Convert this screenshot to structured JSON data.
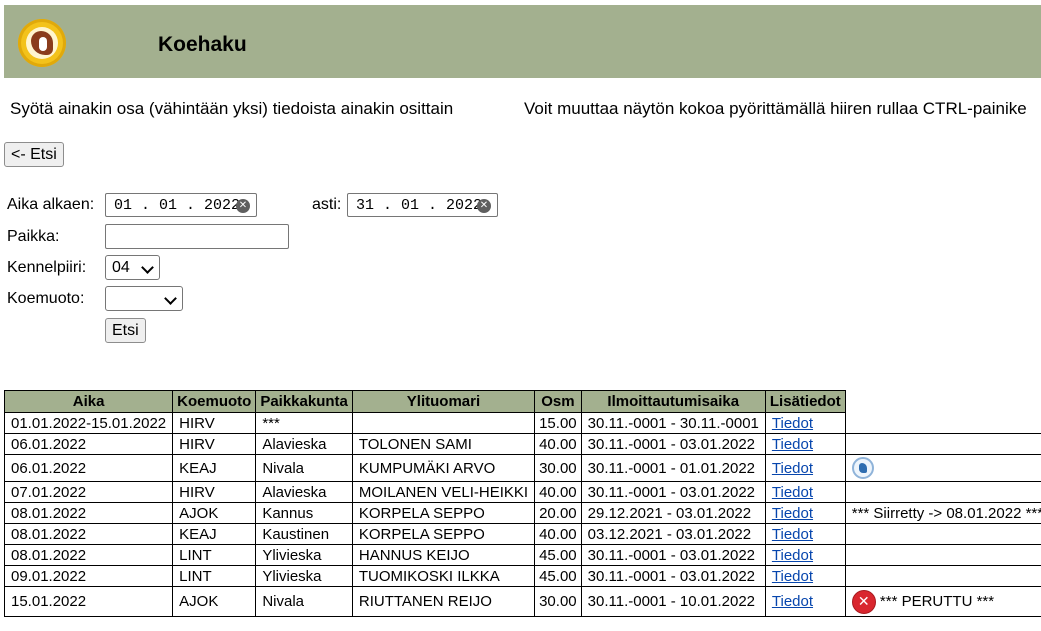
{
  "header": {
    "title": "Koehaku"
  },
  "intro": {
    "left": "Syötä ainakin osa (vähintään yksi) tiedoista ainakin osittain",
    "right": "Voit muuttaa näytön kokoa pyörittämällä hiiren rullaa CTRL-painike"
  },
  "back_button": "<- Etsi",
  "form": {
    "start_label": "Aika alkaen:",
    "start_value": "01 . 01 . 2022",
    "end_label": "asti:",
    "end_value": "31 . 01 . 2022",
    "place_label": "Paikka:",
    "place_value": "",
    "kennel_label": "Kennelpiiri:",
    "kennel_value": "04",
    "type_label": "Koemuoto:",
    "type_value": "",
    "search_button": "Etsi"
  },
  "table": {
    "headers": [
      "Aika",
      "Koemuoto",
      "Paikkakunta",
      "Ylituomari",
      "Osm",
      "Ilmoittautumisaika",
      "Lisätiedot"
    ],
    "rows": [
      {
        "aika": "01.01.2022-15.01.2022",
        "koemuoto": "HIRV",
        "paikka": "***",
        "tuomari": "",
        "osm": "15.00",
        "ilmo": "30.11.-0001 - 30.11.-0001",
        "link": "Tiedot",
        "note": "",
        "icon": "",
        "note_cell": false
      },
      {
        "aika": "06.01.2022",
        "koemuoto": "HIRV",
        "paikka": "Alavieska",
        "tuomari": "TOLONEN SAMI",
        "osm": "40.00",
        "ilmo": "30.11.-0001 - 03.01.2022",
        "link": "Tiedot",
        "note": "",
        "icon": "",
        "note_cell": true
      },
      {
        "aika": "06.01.2022",
        "koemuoto": "KEAJ",
        "paikka": "Nivala",
        "tuomari": "KUMPUMÄKI ARVO",
        "osm": "30.00",
        "ilmo": "30.11.-0001 - 01.01.2022",
        "link": "Tiedot",
        "note": "",
        "icon": "association-logo-icon",
        "note_cell": true
      },
      {
        "aika": "07.01.2022",
        "koemuoto": "HIRV",
        "paikka": "Alavieska",
        "tuomari": "MOILANEN VELI-HEIKKI",
        "osm": "40.00",
        "ilmo": "30.11.-0001 - 03.01.2022",
        "link": "Tiedot",
        "note": "",
        "icon": "",
        "note_cell": true
      },
      {
        "aika": "08.01.2022",
        "koemuoto": "AJOK",
        "paikka": "Kannus",
        "tuomari": "KORPELA SEPPO",
        "osm": "20.00",
        "ilmo": "29.12.2021 - 03.01.2022",
        "link": "Tiedot",
        "note": "*** Siirretty -> 08.01.2022 ***",
        "icon": "",
        "note_cell": true
      },
      {
        "aika": "08.01.2022",
        "koemuoto": "KEAJ",
        "paikka": "Kaustinen",
        "tuomari": "KORPELA SEPPO",
        "osm": "40.00",
        "ilmo": "03.12.2021 - 03.01.2022",
        "link": "Tiedot",
        "note": "",
        "icon": "",
        "note_cell": true
      },
      {
        "aika": "08.01.2022",
        "koemuoto": "LINT",
        "paikka": "Ylivieska",
        "tuomari": "HANNUS KEIJO",
        "osm": "45.00",
        "ilmo": "30.11.-0001 - 03.01.2022",
        "link": "Tiedot",
        "note": "",
        "icon": "",
        "note_cell": true
      },
      {
        "aika": "09.01.2022",
        "koemuoto": "LINT",
        "paikka": "Ylivieska",
        "tuomari": "TUOMIKOSKI ILKKA",
        "osm": "45.00",
        "ilmo": "30.11.-0001 - 03.01.2022",
        "link": "Tiedot",
        "note": "",
        "icon": "",
        "note_cell": true
      },
      {
        "aika": "15.01.2022",
        "koemuoto": "AJOK",
        "paikka": "Nivala",
        "tuomari": "RIUTTANEN REIJO",
        "osm": "30.00",
        "ilmo": "30.11.-0001 - 10.01.2022",
        "link": "Tiedot",
        "note": "*** PERUTTU ***",
        "icon": "cancel-icon",
        "note_cell": true
      }
    ]
  },
  "colors": {
    "header_bg": "#a3b08f",
    "link": "#0645ad",
    "cancel": "#d9262e"
  }
}
